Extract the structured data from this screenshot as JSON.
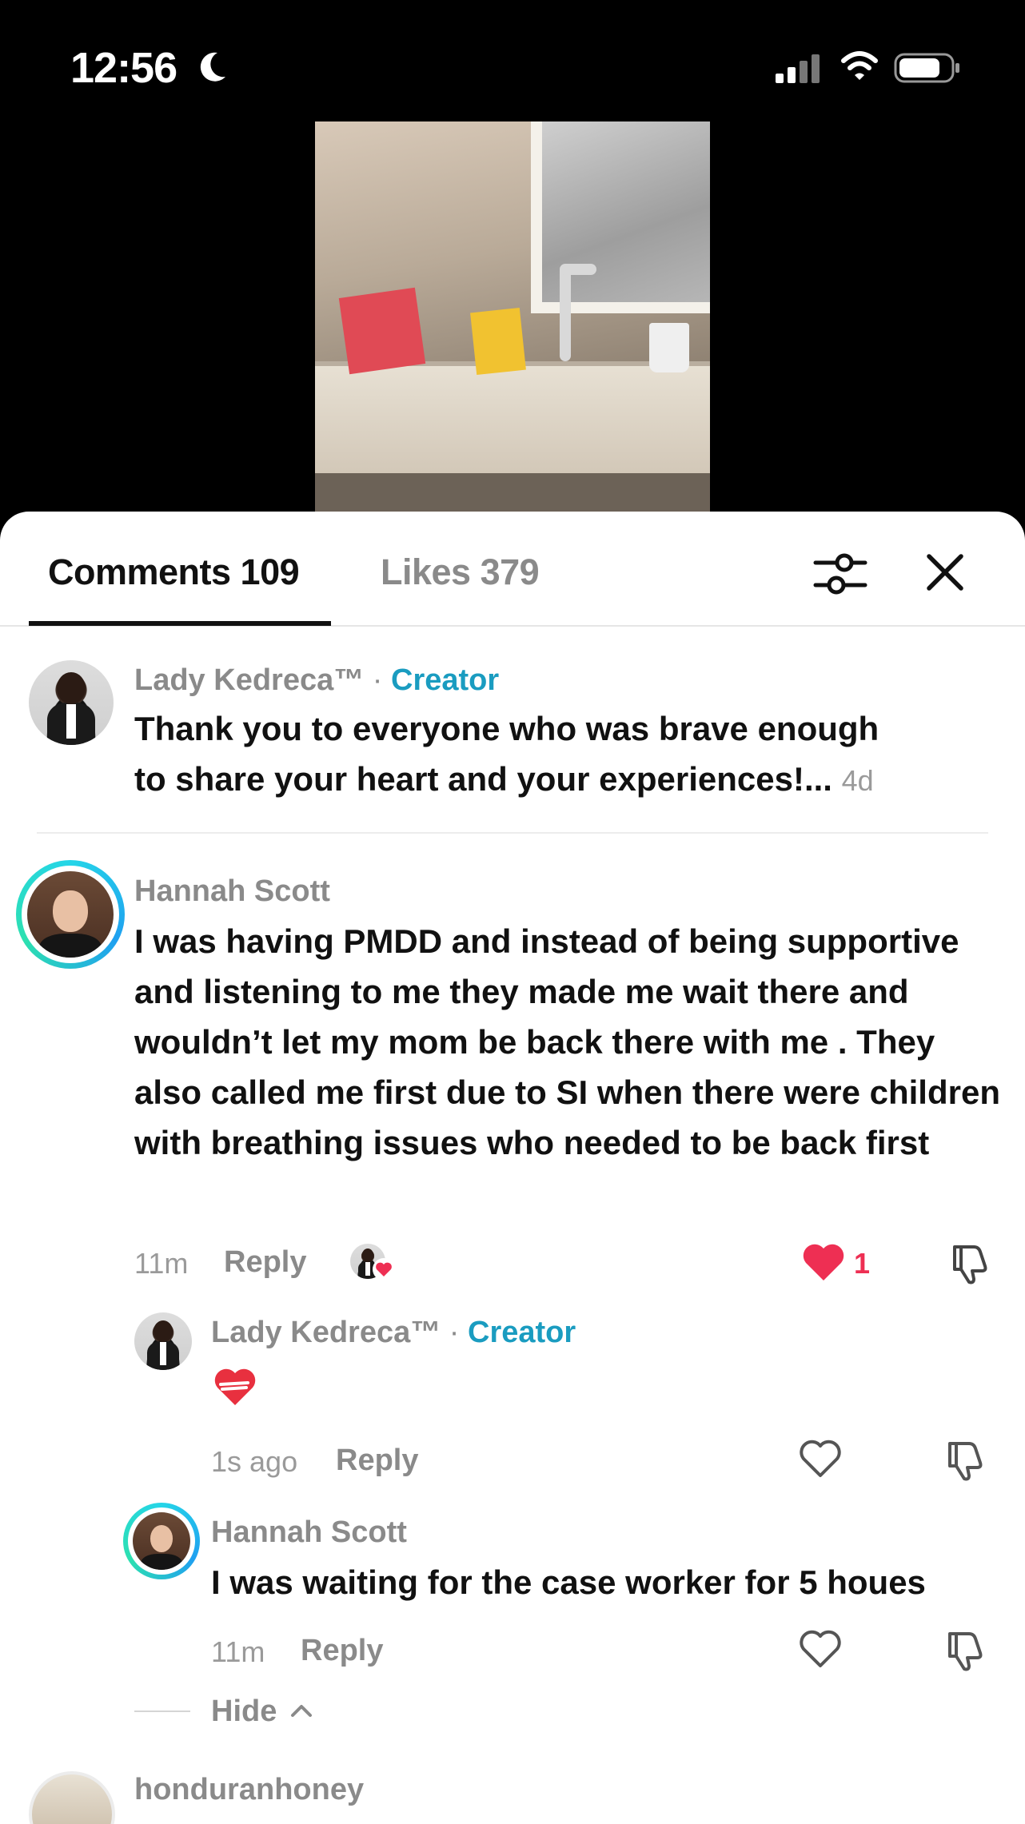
{
  "status_bar": {
    "time": "12:56",
    "focus_icon": "moon-icon",
    "signal_icon": "cellular-signal-icon",
    "wifi_icon": "wifi-icon",
    "battery_icon": "battery-icon"
  },
  "tabs": {
    "comments_label": "Comments 109",
    "likes_label": "Likes 379",
    "active": "comments",
    "filter_icon": "filter-sliders-icon",
    "close_icon": "close-icon"
  },
  "comments": [
    {
      "author": "Lady Kedreca™",
      "badge": "Creator",
      "separator": "·",
      "text_line1": "Thank you to everyone who was brave enough",
      "text_line2": "to share your heart and your experiences!...",
      "time": "4d"
    },
    {
      "author": "Hannah Scott",
      "text": "I was having PMDD and instead of being supportive and listening to me they made me wait there and wouldn’t let my mom be back there with me . They also called me first due to SI when there were children with breathing issues who needed to be back first",
      "time": "11m",
      "reply_label": "Reply",
      "like_count": "1",
      "liked": true,
      "replies": [
        {
          "author": "Lady Kedreca™",
          "badge": "Creator",
          "separator": "·",
          "emoji": "heart-emoji",
          "time": "1s ago",
          "reply_label": "Reply"
        },
        {
          "author": "Hannah Scott",
          "text": "I was waiting for the case worker for 5 houes",
          "time": "11m",
          "reply_label": "Reply"
        }
      ],
      "hide_label": "Hide"
    },
    {
      "author": "honduranhoney"
    }
  ],
  "colors": {
    "creator": "#1a9cc0",
    "like_red": "#ee2f53",
    "muted": "#8a8a8a",
    "text": "#111111"
  }
}
